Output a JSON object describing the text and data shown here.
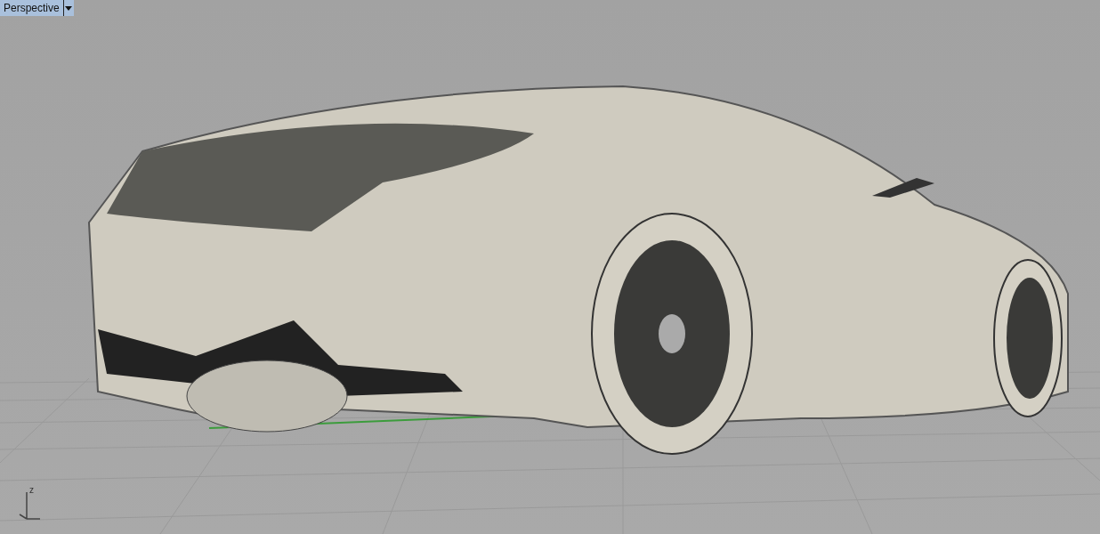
{
  "viewport": {
    "title": "Perspective",
    "axis_label": "z"
  }
}
